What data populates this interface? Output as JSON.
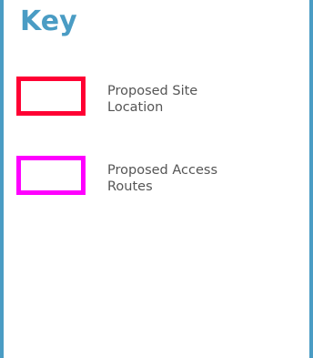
{
  "key": {
    "title": "Key",
    "accent_color": "#4a9cc4",
    "items": [
      {
        "label_line1": "Proposed Site",
        "label_line2": "Location",
        "color": "#ff0033"
      },
      {
        "label_line1": "Proposed Access",
        "label_line2": "Routes",
        "color": "#ff00ff"
      }
    ]
  }
}
